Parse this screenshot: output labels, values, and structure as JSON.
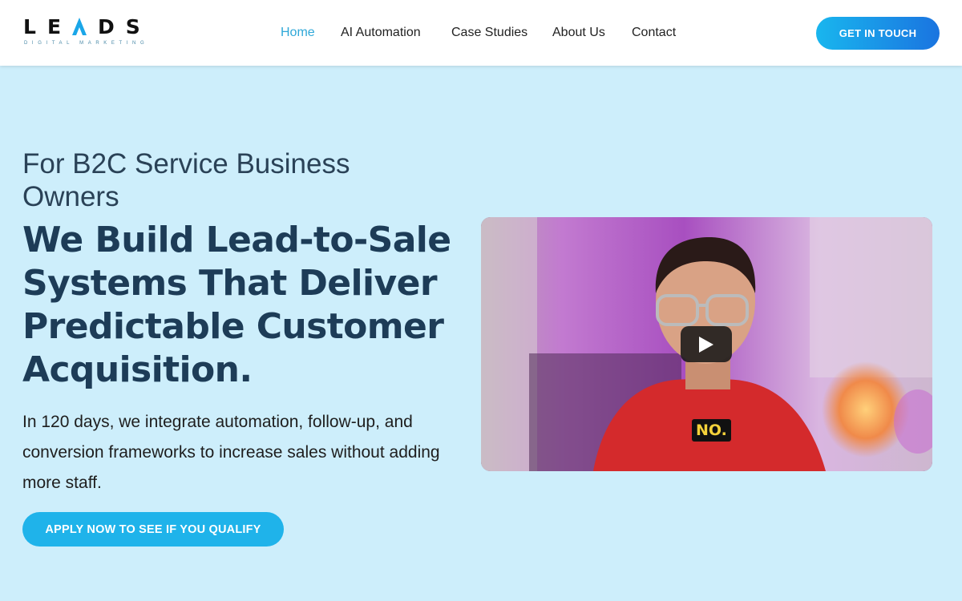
{
  "header": {
    "logo": {
      "word": "LEADS",
      "tagline": "DIGITAL MARKETING"
    },
    "nav": [
      {
        "label": "Home",
        "active": true
      },
      {
        "label": "AI Automation",
        "active": false
      },
      {
        "label": "Case Studies",
        "active": false
      },
      {
        "label": "About Us",
        "active": false
      },
      {
        "label": "Contact",
        "active": false
      }
    ],
    "cta_label": "GET IN TOUCH"
  },
  "hero": {
    "eyebrow": "For B2C Service Business Owners",
    "headline": "We Build Lead-to-Sale Systems That Deliver Predictable Customer Acquisition.",
    "description": "In 120 days, we integrate automation, follow-up, and conversion frameworks to increase sales without adding more staff.",
    "cta_label": "APPLY NOW TO SEE IF YOU QUALIFY"
  },
  "video": {
    "caption": "NO.",
    "play_icon": "play-icon"
  },
  "colors": {
    "page_bg": "#cdeefb",
    "accent": "#1fb3ea",
    "headline": "#1d3c57",
    "nav_active": "#2fa8d8"
  }
}
